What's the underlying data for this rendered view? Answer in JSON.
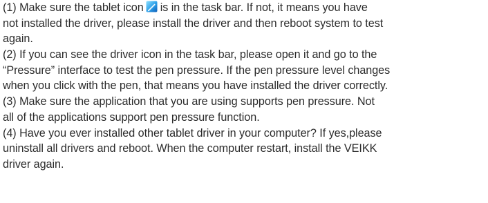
{
  "paragraphs": [
    {
      "lines": [
        {
          "before_icon": "(1) Make sure the tablet icon",
          "after_icon": "is in the task bar. If not, it means you have",
          "icon": "tablet-driver-icon"
        },
        {
          "text": "not installed the driver, please install the driver and then reboot system to test"
        },
        {
          "text": "again."
        }
      ]
    },
    {
      "lines": [
        {
          "text": "(2) If you can see the driver icon in the task bar, please open it and go to the"
        },
        {
          "text": "“Pressure” interface to test the pen pressure. If the pen pressure level changes"
        },
        {
          "text": "when you click with the pen, that means you have installed the driver correctly."
        }
      ]
    },
    {
      "lines": [
        {
          "text": "(3) Make sure the application that you are using supports pen pressure. Not"
        },
        {
          "text": "all of the applications support pen pressure function."
        }
      ]
    },
    {
      "lines": [
        {
          "text": "(4) Have you ever installed other tablet driver in your computer? If yes,please"
        },
        {
          "text": "uninstall all drivers and reboot. When the computer restart, install the VEIKK"
        },
        {
          "text": "driver again."
        }
      ]
    }
  ]
}
